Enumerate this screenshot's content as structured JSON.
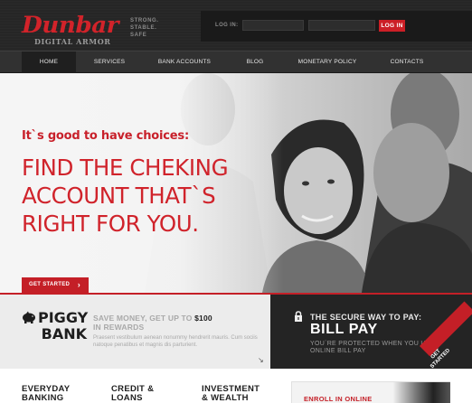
{
  "brand": {
    "logo_main": "Dunbar",
    "logo_sub": "DIGITAL ARMOR",
    "tagline": [
      "STRONG.",
      "STABLE.",
      "SAFE"
    ]
  },
  "login": {
    "label": "LOG IN:",
    "username_placeholder": "",
    "password_placeholder": "",
    "button": "LOG IN"
  },
  "nav": {
    "items": [
      "HOME",
      "SERVICES",
      "BANK ACCOUNTS",
      "BLOG",
      "MONETARY POLICY",
      "CONTACTS"
    ],
    "active": "HOME"
  },
  "hero": {
    "kicker": "It`s good to have choices:",
    "headline": [
      "FIND THE CHEKING",
      "ACCOUNT THAT`S",
      "RIGHT FOR YOU."
    ],
    "cta": "GET STARTED"
  },
  "piggy": {
    "title": [
      "PIGGY",
      "BANK"
    ],
    "save_prefix": "SAVE MONEY, GET UP TO",
    "save_amount": "$100",
    "save_suffix": "IN REWARDS",
    "desc": "Praesent vestibulum aenean nonummy hendrerit mauris. Cum sociis natoque penatibus et magnis dis parturient."
  },
  "billpay": {
    "kicker": "THE SECURE WAY TO PAY:",
    "title": "BILL PAY",
    "desc": "YOU`RE PROTECTED WHEN YOU USE ONLINE BILL PAY",
    "ribbon": "GET STARTED"
  },
  "categories": [
    [
      "EVERYDAY",
      "BANKING"
    ],
    [
      "CREDIT &",
      "LOANS"
    ],
    [
      "INVESTMENT",
      "& WEALTH"
    ]
  ],
  "enroll": {
    "text": "ENROLL IN ONLINE"
  },
  "colors": {
    "accent": "#c41f27",
    "dark": "#262626"
  }
}
